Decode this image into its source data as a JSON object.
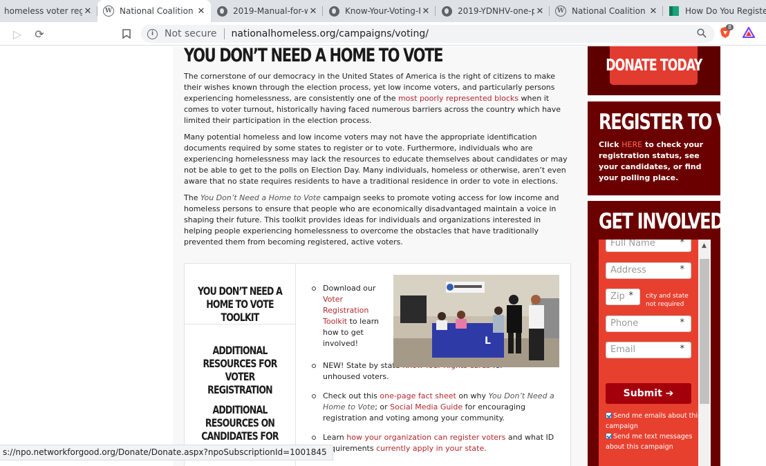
{
  "browser": {
    "tabs": [
      {
        "title": "homeless voter regis",
        "favicon": "globe-icon"
      },
      {
        "title": "National Coalition fo",
        "favicon": "wordpress-icon"
      },
      {
        "title": "2019-Manual-for-we",
        "favicon": "globe-icon"
      },
      {
        "title": "Know-Your-Voting-F",
        "favicon": "globe-icon"
      },
      {
        "title": "2019-YDNHV-one-p",
        "favicon": "globe-icon"
      },
      {
        "title": "National Coalition fo",
        "favicon": "wordpress-icon"
      },
      {
        "title": "How Do You Registe",
        "favicon": "green-icon"
      }
    ],
    "security_label": "Not secure",
    "url": "nationalhomeless.org/campaigns/voting/",
    "extension_badge": "8",
    "status_url": "s://npo.networkforgood.org/Donate/Donate.aspx?npoSubscriptionId=1001845"
  },
  "main": {
    "title": "YOU DON’T NEED A HOME TO VOTE",
    "p1_a": "The cornerstone of our democracy in the United States of America is the right of citizens to make their wishes known through the election process, yet low income voters, and particularly persons experiencing homelessness, are consistently one of the ",
    "p1_link": "most poorly represented blocks",
    "p1_b": " when it comes to voter turnout, historically having faced numerous barriers across the country which have limited their participation in the election process.",
    "p2": "Many potential homeless and low income voters may not have the appropriate identification documents required by some states to register or to vote. Furthermore, individuals who are experiencing homelessness may lack the resources to educate themselves about candidates or may not be able to get to the polls on Election Day. Many individuals, homeless or otherwise, aren’t even aware that no state requires residents to have a traditional residence in order to vote in elections.",
    "p3_a": "The ",
    "p3_em": "You Don’t Need a Home to Vote",
    "p3_b": " campaign seeks to promote voting access for low income and homeless persons to ensure that people who are economically disadvantaged maintain a voice in shaping their future. This toolkit provides ideas for individuals and organizations interested in helping people experiencing homelessness to overcome the obstacles that have traditionally prevented them from becoming registered, active voters."
  },
  "resources": {
    "nav": [
      "YOU DON’T NEED A HOME TO VOTE TOOLKIT",
      "ADDITIONAL RESOURCES FOR VOTER REGISTRATION",
      "ADDITIONAL RESOURCES ON CANDIDATES FOR PUBLIC OFFICE"
    ],
    "item1_a": "Download our ",
    "item1_link": "Voter Registration Toolkit",
    "item1_b": " to learn how to get involved!",
    "item2_a": "NEW! State by state ",
    "item2_link": "Know-Your-Rights cards",
    "item2_b": " for unhoused voters.",
    "item3_a": "Check out this ",
    "item3_link1": "one-page fact sheet",
    "item3_b": " on why ",
    "item3_em": "You Don’t Need a Home to Vote",
    "item3_c": "; or ",
    "item3_link2": "Social Media Guide",
    "item3_d": " for encouraging registration and voting among your community.",
    "item4_a": "Learn ",
    "item4_link1": "how your organization can register voters",
    "item4_b": " and what ID requirements ",
    "item4_link2": "currently apply in your state",
    "item4_c": "."
  },
  "sidebar": {
    "donate_label": "DONATE TODAY",
    "register_title": "REGISTER TO VOTE",
    "register_a": "Click ",
    "register_link": "HERE",
    "register_b": " to check your registration status, see your candidates, or find your polling place.",
    "involved_title": "GET INVOLVED",
    "form": {
      "full_name": "Full Name",
      "address": "Address",
      "zip": "Zip",
      "zip_note": "city and state not required",
      "phone": "Phone",
      "email": "Email",
      "required_mark": "*",
      "submit_label": "Submit ➔",
      "email_opt": "Send me emails about this campaign",
      "text_opt": "Send me text messages about this campaign"
    }
  },
  "colors": {
    "sidebar_dark": "#6b0000",
    "accent_red": "#e8402f",
    "link_red": "#b3262c"
  }
}
